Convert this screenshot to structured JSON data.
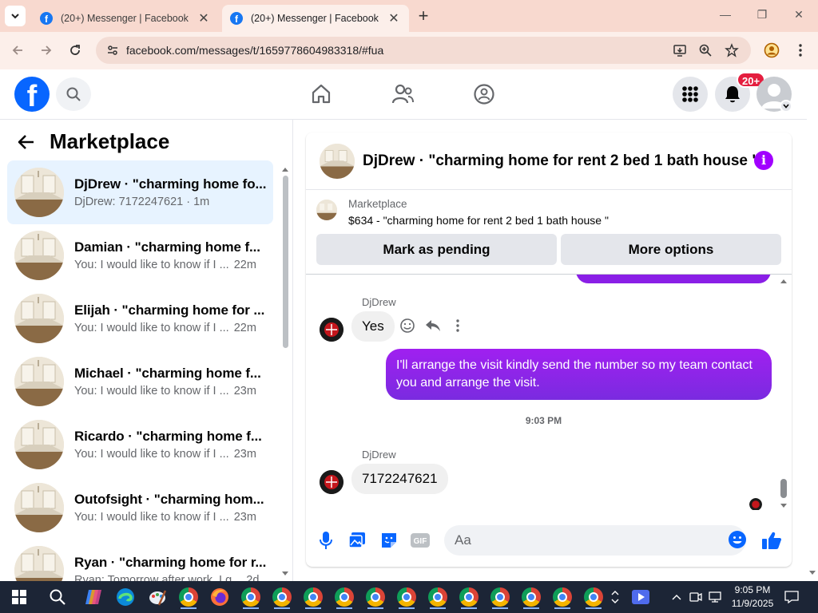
{
  "browser": {
    "tabs": [
      {
        "title": "(20+) Messenger | Facebook",
        "active": false
      },
      {
        "title": "(20+) Messenger | Facebook",
        "active": true
      }
    ],
    "url": "facebook.com/messages/t/1659778604983318/#fua"
  },
  "header": {
    "notification_badge": "20+"
  },
  "sidebar": {
    "title": "Marketplace",
    "conversations": [
      {
        "name": "DjDrew · \"charming home fo...",
        "snippet": "DjDrew: 7172247621 · 1m",
        "time": "",
        "selected": true
      },
      {
        "name": "Damian · \"charming home f...",
        "snippet": "You: I would like to know if I ...",
        "time": "22m",
        "selected": false
      },
      {
        "name": "Elijah · \"charming home for ...",
        "snippet": "You: I would like to know if I ...",
        "time": "22m",
        "selected": false
      },
      {
        "name": "Michael · \"charming home f...",
        "snippet": "You: I would like to know if I ...",
        "time": "23m",
        "selected": false
      },
      {
        "name": "Ricardo · \"charming home f...",
        "snippet": "You: I would like to know if I ...",
        "time": "23m",
        "selected": false
      },
      {
        "name": "Outofsight · \"charming hom...",
        "snippet": "You: I would like to know if I ...",
        "time": "23m",
        "selected": false
      },
      {
        "name": "Ryan · \"charming home for r...",
        "snippet": "Ryan: Tomorrow after work, I g...",
        "time": "2d",
        "selected": false
      }
    ]
  },
  "chat": {
    "title": "DjDrew · \"charming home for rent 2 bed 1 bath house \"",
    "marketplace": {
      "label": "Marketplace",
      "listing": "$634 - \"charming home for rent 2 bed 1 bath house \"",
      "pending_button": "Mark as pending",
      "options_button": "More options"
    },
    "messages": {
      "sender1": "DjDrew",
      "msg1": "Yes",
      "outgoing": "I'll arrange the visit kindly send the number so my team contact you and arrange the visit.",
      "timestamp": "9:03 PM",
      "sender2": "DjDrew",
      "msg2": "7172247621"
    },
    "composer_placeholder": "Aa"
  },
  "taskbar": {
    "time": "9:05 PM",
    "date": "11/9/2025"
  },
  "colors": {
    "facebook_blue": "#0866ff",
    "messenger_purple": "#a100ff",
    "selected_bg": "#e7f3ff",
    "badge_red": "#e41e3f"
  }
}
